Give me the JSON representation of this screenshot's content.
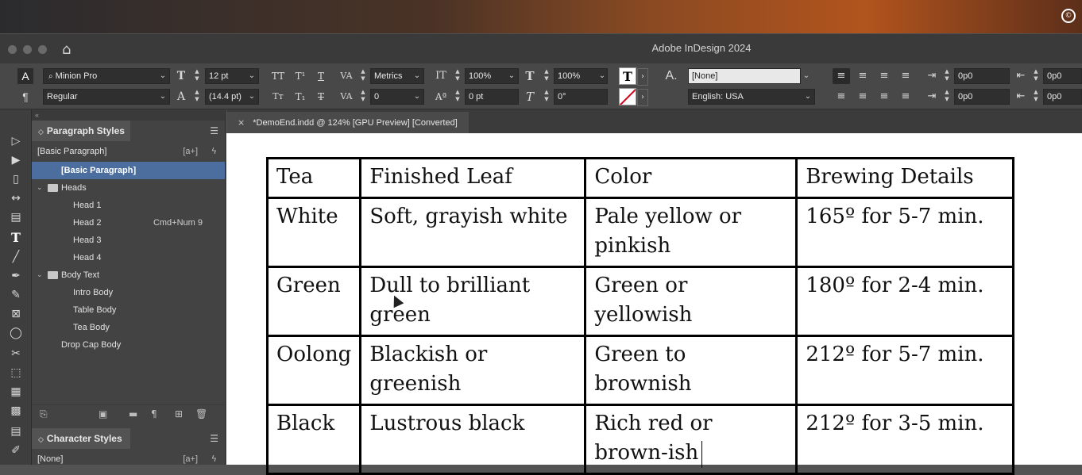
{
  "menubar": {
    "apple": "",
    "right_icon": "©"
  },
  "app": {
    "title": "Adobe InDesign 2024"
  },
  "control": {
    "mode_char": "A",
    "mode_para": "¶",
    "font_family": "Minion Pro",
    "font_style": "Regular",
    "font_size": "12 pt",
    "leading": "(14.4 pt)",
    "kerning": "Metrics",
    "tracking": "0",
    "vscale": "100%",
    "hscale": "100%",
    "baseline": "0 pt",
    "skew": "0°",
    "char_style": "[None]",
    "language": "English: USA",
    "left_indent": "0p0",
    "first_indent": "0p0",
    "right_indent": "0p0",
    "last_indent": "0p0"
  },
  "panel": {
    "para_title": "Paragraph Styles",
    "current_style": "[Basic Paragraph]",
    "items": [
      {
        "label": "[Basic Paragraph]",
        "shortcut": ""
      },
      {
        "label": "Heads",
        "shortcut": ""
      },
      {
        "label": "Head 1",
        "shortcut": ""
      },
      {
        "label": "Head 2",
        "shortcut": "Cmd+Num 9"
      },
      {
        "label": "Head 3",
        "shortcut": ""
      },
      {
        "label": "Head 4",
        "shortcut": ""
      },
      {
        "label": "Body Text",
        "shortcut": ""
      },
      {
        "label": "Intro Body",
        "shortcut": ""
      },
      {
        "label": "Table Body",
        "shortcut": ""
      },
      {
        "label": "Tea Body",
        "shortcut": ""
      },
      {
        "label": "Drop Cap Body",
        "shortcut": ""
      }
    ],
    "char_title": "Character Styles",
    "char_current": "[None]"
  },
  "document": {
    "tab": "*DemoEnd.indd @ 124% [GPU Preview] [Converted]"
  },
  "table": {
    "header": [
      "Tea",
      "Finished Leaf",
      "Color",
      "Brewing Details"
    ],
    "rows": [
      [
        "White",
        "Soft, grayish white",
        "Pale yellow or pinkish",
        "165º for 5-7 min."
      ],
      [
        "Green",
        "Dull to brilliant green",
        "Green or yellowish",
        "180º for 2-4 min."
      ],
      [
        "Oolong",
        "Blackish or greenish",
        "Green to brownish",
        "212º for 5-7 min."
      ],
      [
        "Black",
        "Lustrous black",
        "Rich red or brown-ish",
        "212º for 3-5 min."
      ]
    ]
  }
}
